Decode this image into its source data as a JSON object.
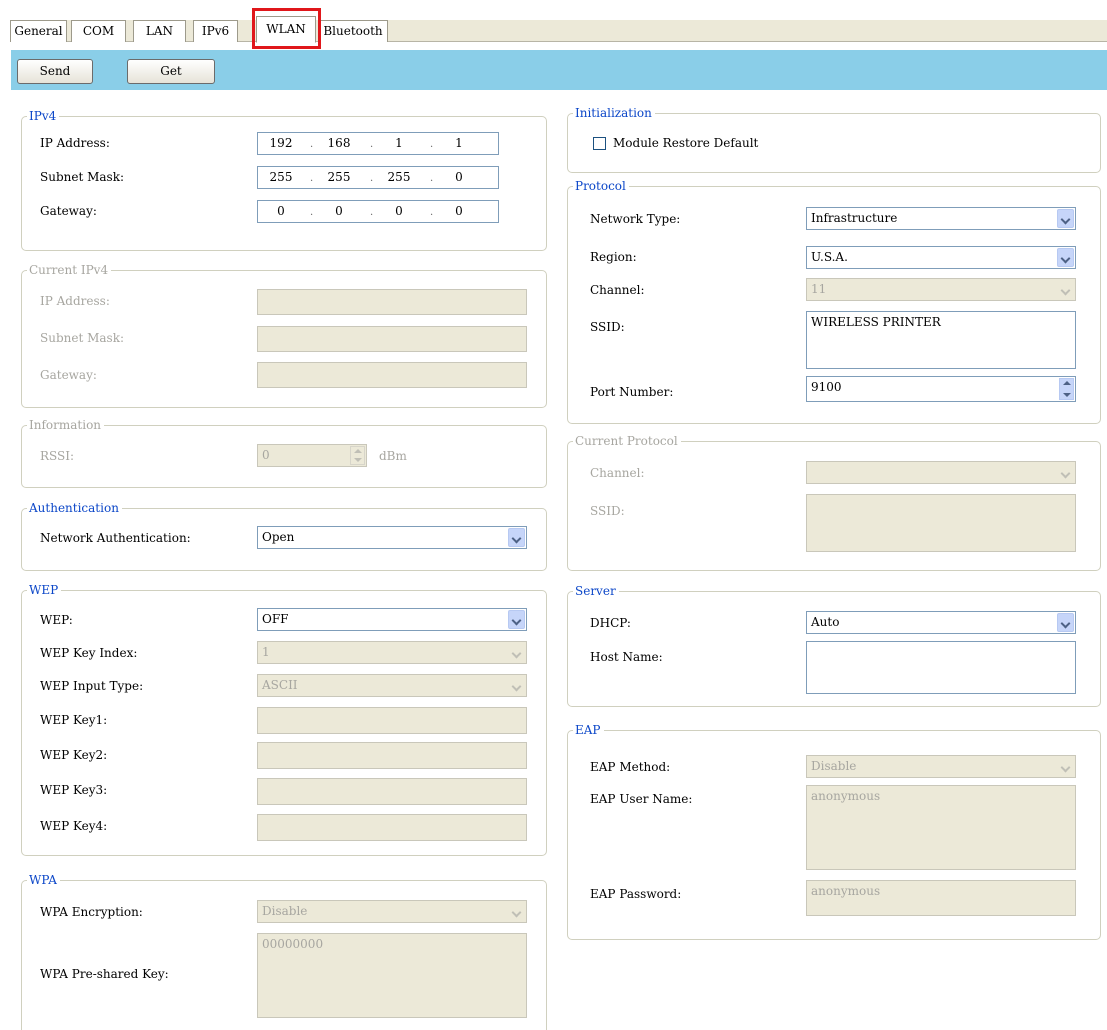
{
  "tabs": [
    "General",
    "COM",
    "LAN",
    "IPv6",
    "WLAN",
    "Bluetooth"
  ],
  "active_tab": "WLAN",
  "toolbar": {
    "send": "Send",
    "get": "Get"
  },
  "ipv4": {
    "title": "IPv4",
    "ip_label": "IP Address:",
    "ip": [
      "192",
      "168",
      "1",
      "1"
    ],
    "mask_label": "Subnet Mask:",
    "mask": [
      "255",
      "255",
      "255",
      "0"
    ],
    "gw_label": "Gateway:",
    "gw": [
      "0",
      "0",
      "0",
      "0"
    ]
  },
  "current_ipv4": {
    "title": "Current IPv4",
    "ip_label": "IP Address:",
    "mask_label": "Subnet Mask:",
    "gw_label": "Gateway:"
  },
  "information": {
    "title": "Information",
    "rssi_label": "RSSI:",
    "rssi_value": "0",
    "rssi_unit": "dBm"
  },
  "authentication": {
    "title": "Authentication",
    "label": "Network Authentication:",
    "value": "Open"
  },
  "wep": {
    "title": "WEP",
    "wep_label": "WEP:",
    "wep_value": "OFF",
    "key_index_label": "WEP Key Index:",
    "key_index_value": "1",
    "input_type_label": "WEP Input Type:",
    "input_type_value": "ASCII",
    "key1_label": "WEP Key1:",
    "key2_label": "WEP Key2:",
    "key3_label": "WEP Key3:",
    "key4_label": "WEP Key4:"
  },
  "wpa": {
    "title": "WPA",
    "encryption_label": "WPA Encryption:",
    "encryption_value": "Disable",
    "psk_label": "WPA Pre-shared Key:",
    "psk_value": "00000000"
  },
  "initialization": {
    "title": "Initialization",
    "restore_label": "Module Restore Default"
  },
  "protocol": {
    "title": "Protocol",
    "network_type_label": "Network Type:",
    "network_type_value": "Infrastructure",
    "region_label": "Region:",
    "region_value": "U.S.A.",
    "channel_label": "Channel:",
    "channel_value": "11",
    "ssid_label": "SSID:",
    "ssid_value": "WIRELESS PRINTER",
    "port_label": "Port Number:",
    "port_value": "9100"
  },
  "current_protocol": {
    "title": "Current Protocol",
    "channel_label": "Channel:",
    "ssid_label": "SSID:"
  },
  "server": {
    "title": "Server",
    "dhcp_label": "DHCP:",
    "dhcp_value": "Auto",
    "host_label": "Host Name:"
  },
  "eap": {
    "title": "EAP",
    "method_label": "EAP Method:",
    "method_value": "Disable",
    "user_label": "EAP User Name:",
    "user_value": "anonymous",
    "password_label": "EAP Password:",
    "password_value": "anonymous"
  },
  "colors": {
    "toolbar": "#8acee8",
    "legend": "#0b46c8",
    "highlight": "#e0171b"
  }
}
